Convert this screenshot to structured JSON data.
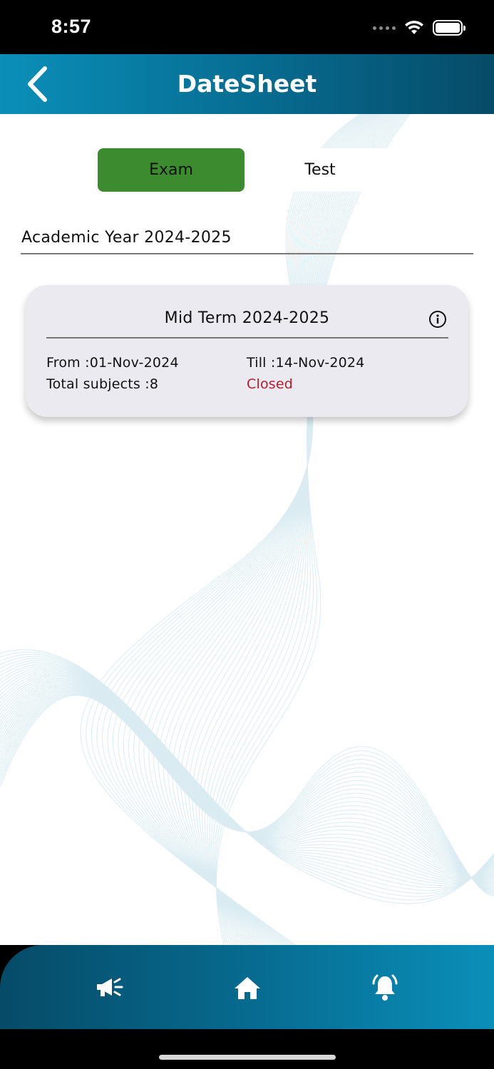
{
  "status_bar": {
    "time": "8:57"
  },
  "header": {
    "title": "DateSheet",
    "back_icon": "chevron-left-icon"
  },
  "tabs": [
    {
      "label": "Exam",
      "active": true,
      "color": "#3c8c2f"
    },
    {
      "label": "Test",
      "active": false
    }
  ],
  "academic_year": "Academic Year 2024-2025",
  "exam_card": {
    "title": "Mid Term 2024-2025",
    "from": "From :01-Nov-2024",
    "till": "Till :14-Nov-2024",
    "total_subjects": "Total subjects :8",
    "status": "Closed",
    "status_color": "#b51d2c",
    "info_icon": "info-icon"
  },
  "bottom_nav": {
    "items": [
      "megaphone-icon",
      "home-icon",
      "bell-icon"
    ]
  },
  "colors": {
    "header_gradient_start": "#0a8fb9",
    "header_gradient_end": "#064b68"
  }
}
